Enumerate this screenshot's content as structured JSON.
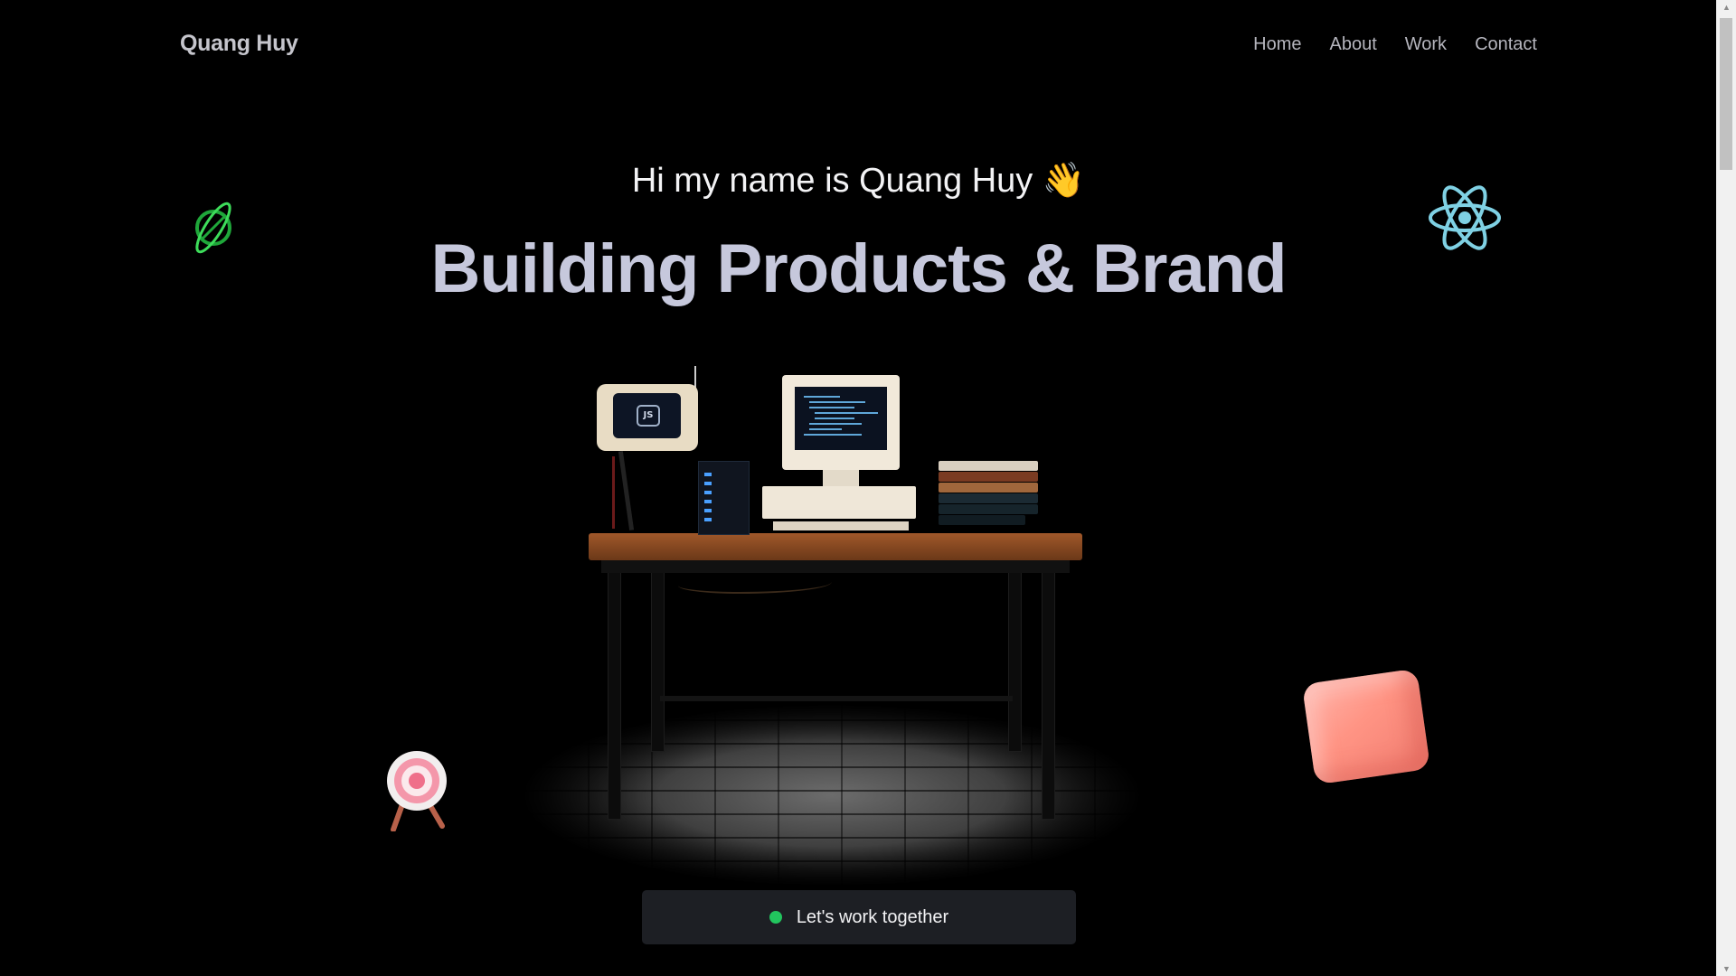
{
  "nav": {
    "brand": "Quang Huy",
    "links": [
      "Home",
      "About",
      "Work",
      "Contact"
    ]
  },
  "hero": {
    "greeting": "Hi my name is Quang Huy 👋",
    "headline": "Building Products & Brand",
    "tv_logo": "JS"
  },
  "cta": {
    "label": "Let's work together",
    "status_color": "#22c55e"
  },
  "icons": [
    "saturn-icon",
    "react-icon",
    "target-icon",
    "cube-icon"
  ],
  "colors": {
    "background": "#000000",
    "headline": "#c6c8dc",
    "cta_background": "#1d1f24"
  },
  "scrollbar": {
    "up": "▲",
    "down": "▼"
  }
}
